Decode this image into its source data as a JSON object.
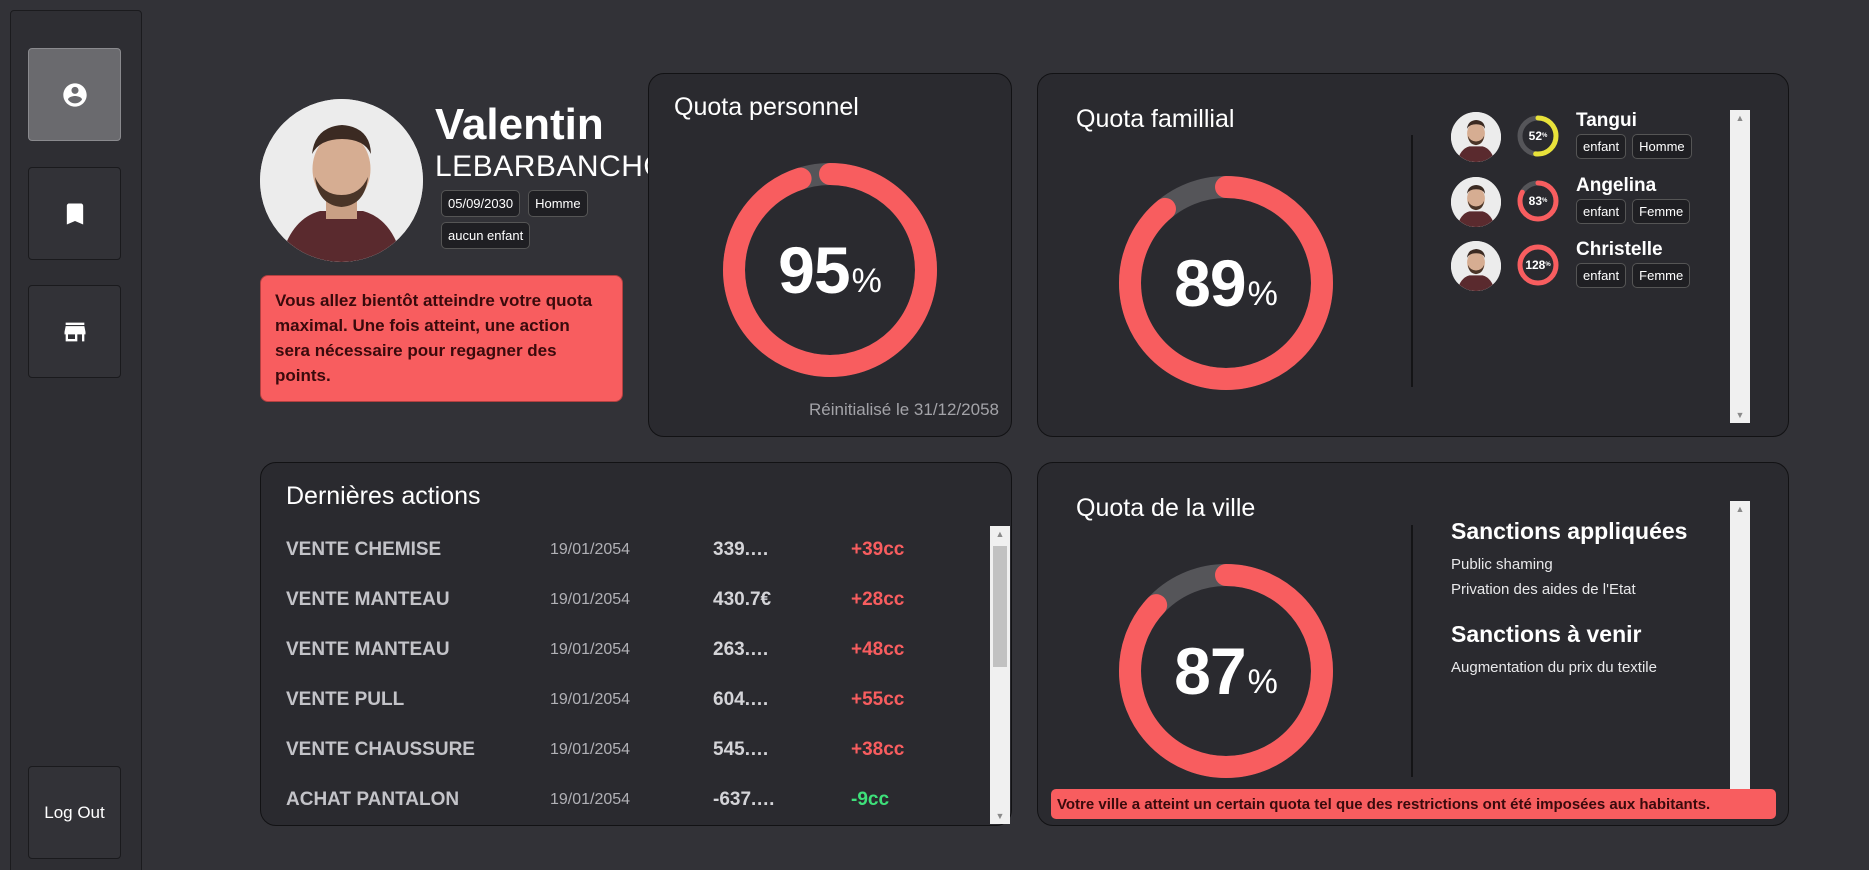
{
  "sidebar": {
    "items": [
      {
        "name": "profile",
        "icon": "account-circle-icon",
        "active": true
      },
      {
        "name": "bookmarks",
        "icon": "bookmark-icon",
        "active": false
      },
      {
        "name": "store",
        "icon": "store-icon",
        "active": false
      }
    ],
    "logout_label": "Log Out"
  },
  "profile": {
    "first_name": "Valentin",
    "last_name": "LEBARBANCHON",
    "birth_date": "05/09/2030",
    "gender": "Homme",
    "children": "aucun enfant",
    "alert": "Vous allez bientôt atteindre votre quota maximal. Une fois atteint, une action sera nécessaire pour regagner des points."
  },
  "personal_quota": {
    "title": "Quota personnel",
    "value": 95,
    "unit": "%",
    "reset": "Réinitialisé le 31/12/2058"
  },
  "family_quota": {
    "title": "Quota famillial",
    "value": 89,
    "unit": "%",
    "members": [
      {
        "name": "Tangui",
        "percent": "52",
        "percent_value": 52,
        "ring_color": "#e8e23a",
        "role": "enfant",
        "gender": "Homme"
      },
      {
        "name": "Angelina",
        "percent": "83",
        "percent_value": 83,
        "ring_color": "#f85d5f",
        "role": "enfant",
        "gender": "Femme"
      },
      {
        "name": "Christelle",
        "percent": "128",
        "percent_value": 128,
        "ring_color": "#f85d5f",
        "role": "enfant",
        "gender": "Femme"
      }
    ]
  },
  "actions": {
    "title": "Dernières actions",
    "rows": [
      {
        "label": "VENTE CHEMISE",
        "date": "19/01/2054",
        "amount": "339.…",
        "points": "+39cc",
        "positive": true
      },
      {
        "label": "VENTE MANTEAU",
        "date": "19/01/2054",
        "amount": "430.7€",
        "points": "+28cc",
        "positive": true
      },
      {
        "label": "VENTE MANTEAU",
        "date": "19/01/2054",
        "amount": "263.…",
        "points": "+48cc",
        "positive": true
      },
      {
        "label": "VENTE PULL",
        "date": "19/01/2054",
        "amount": "604.…",
        "points": "+55cc",
        "positive": true
      },
      {
        "label": "VENTE CHAUSSURE",
        "date": "19/01/2054",
        "amount": "545.…",
        "points": "+38cc",
        "positive": true
      },
      {
        "label": "ACHAT PANTALON",
        "date": "19/01/2054",
        "amount": "-637.…",
        "points": "-9cc",
        "positive": false
      }
    ]
  },
  "city_quota": {
    "title": "Quota de la ville",
    "value": 87,
    "unit": "%",
    "applied_title": "Sanctions appliquées",
    "applied": [
      "Public shaming",
      "Privation des aides de l'Etat"
    ],
    "upcoming_title": "Sanctions à venir",
    "upcoming": [
      "Augmentation du prix du textile"
    ],
    "alert": "Votre ville a atteint un certain quota tel que des restrictions ont été imposées aux habitants."
  },
  "colors": {
    "accent": "#f85d5f",
    "positive": "#f85d5f",
    "negative": "#3ee07a",
    "ring_track": "#555559",
    "yellow": "#e8e23a"
  }
}
